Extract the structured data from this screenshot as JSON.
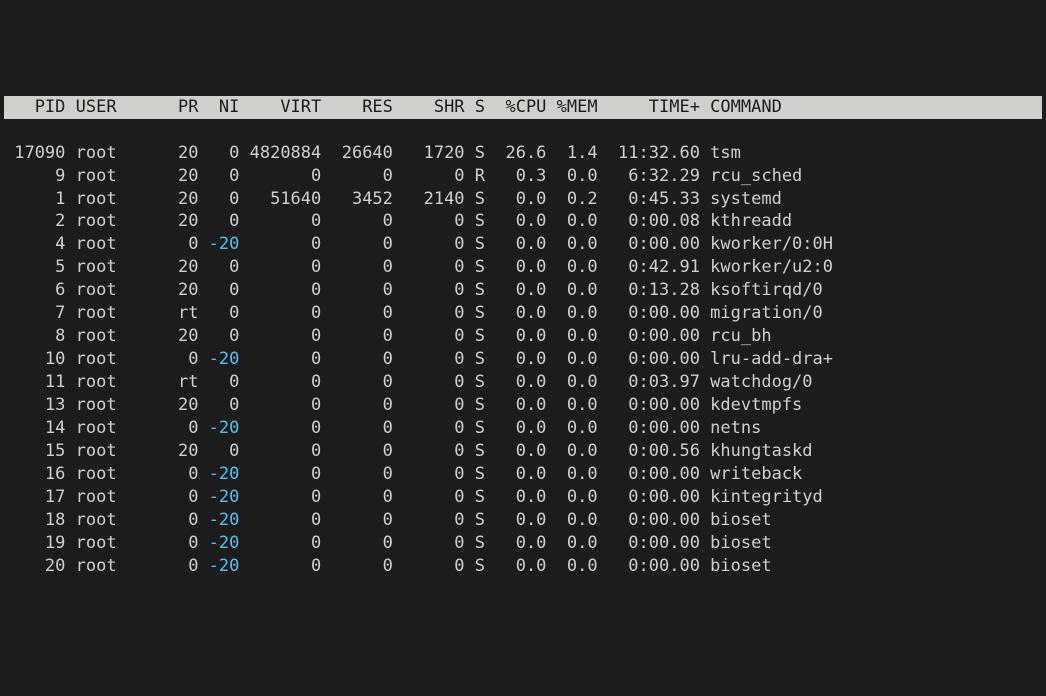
{
  "headers": {
    "pid": "PID",
    "user": "USER",
    "pr": "PR",
    "ni": "NI",
    "virt": "VIRT",
    "res": "RES",
    "shr": "SHR",
    "s": "S",
    "cpu": "%CPU",
    "mem": "%MEM",
    "time": "TIME+",
    "cmd": "COMMAND"
  },
  "rows": [
    {
      "pid": "17090",
      "user": "root",
      "pr": "20",
      "ni": "0",
      "virt": "4820884",
      "res": "26640",
      "shr": "1720",
      "s": "S",
      "cpu": "26.6",
      "mem": "1.4",
      "time": "11:32.60",
      "cmd": "tsm"
    },
    {
      "pid": "9",
      "user": "root",
      "pr": "20",
      "ni": "0",
      "virt": "0",
      "res": "0",
      "shr": "0",
      "s": "R",
      "cpu": "0.3",
      "mem": "0.0",
      "time": "6:32.29",
      "cmd": "rcu_sched"
    },
    {
      "pid": "1",
      "user": "root",
      "pr": "20",
      "ni": "0",
      "virt": "51640",
      "res": "3452",
      "shr": "2140",
      "s": "S",
      "cpu": "0.0",
      "mem": "0.2",
      "time": "0:45.33",
      "cmd": "systemd"
    },
    {
      "pid": "2",
      "user": "root",
      "pr": "20",
      "ni": "0",
      "virt": "0",
      "res": "0",
      "shr": "0",
      "s": "S",
      "cpu": "0.0",
      "mem": "0.0",
      "time": "0:00.08",
      "cmd": "kthreadd"
    },
    {
      "pid": "4",
      "user": "root",
      "pr": "0",
      "ni": "-20",
      "virt": "0",
      "res": "0",
      "shr": "0",
      "s": "S",
      "cpu": "0.0",
      "mem": "0.0",
      "time": "0:00.00",
      "cmd": "kworker/0:0H"
    },
    {
      "pid": "5",
      "user": "root",
      "pr": "20",
      "ni": "0",
      "virt": "0",
      "res": "0",
      "shr": "0",
      "s": "S",
      "cpu": "0.0",
      "mem": "0.0",
      "time": "0:42.91",
      "cmd": "kworker/u2:0"
    },
    {
      "pid": "6",
      "user": "root",
      "pr": "20",
      "ni": "0",
      "virt": "0",
      "res": "0",
      "shr": "0",
      "s": "S",
      "cpu": "0.0",
      "mem": "0.0",
      "time": "0:13.28",
      "cmd": "ksoftirqd/0"
    },
    {
      "pid": "7",
      "user": "root",
      "pr": "rt",
      "ni": "0",
      "virt": "0",
      "res": "0",
      "shr": "0",
      "s": "S",
      "cpu": "0.0",
      "mem": "0.0",
      "time": "0:00.00",
      "cmd": "migration/0"
    },
    {
      "pid": "8",
      "user": "root",
      "pr": "20",
      "ni": "0",
      "virt": "0",
      "res": "0",
      "shr": "0",
      "s": "S",
      "cpu": "0.0",
      "mem": "0.0",
      "time": "0:00.00",
      "cmd": "rcu_bh"
    },
    {
      "pid": "10",
      "user": "root",
      "pr": "0",
      "ni": "-20",
      "virt": "0",
      "res": "0",
      "shr": "0",
      "s": "S",
      "cpu": "0.0",
      "mem": "0.0",
      "time": "0:00.00",
      "cmd": "lru-add-dra+"
    },
    {
      "pid": "11",
      "user": "root",
      "pr": "rt",
      "ni": "0",
      "virt": "0",
      "res": "0",
      "shr": "0",
      "s": "S",
      "cpu": "0.0",
      "mem": "0.0",
      "time": "0:03.97",
      "cmd": "watchdog/0"
    },
    {
      "pid": "13",
      "user": "root",
      "pr": "20",
      "ni": "0",
      "virt": "0",
      "res": "0",
      "shr": "0",
      "s": "S",
      "cpu": "0.0",
      "mem": "0.0",
      "time": "0:00.00",
      "cmd": "kdevtmpfs"
    },
    {
      "pid": "14",
      "user": "root",
      "pr": "0",
      "ni": "-20",
      "virt": "0",
      "res": "0",
      "shr": "0",
      "s": "S",
      "cpu": "0.0",
      "mem": "0.0",
      "time": "0:00.00",
      "cmd": "netns"
    },
    {
      "pid": "15",
      "user": "root",
      "pr": "20",
      "ni": "0",
      "virt": "0",
      "res": "0",
      "shr": "0",
      "s": "S",
      "cpu": "0.0",
      "mem": "0.0",
      "time": "0:00.56",
      "cmd": "khungtaskd"
    },
    {
      "pid": "16",
      "user": "root",
      "pr": "0",
      "ni": "-20",
      "virt": "0",
      "res": "0",
      "shr": "0",
      "s": "S",
      "cpu": "0.0",
      "mem": "0.0",
      "time": "0:00.00",
      "cmd": "writeback"
    },
    {
      "pid": "17",
      "user": "root",
      "pr": "0",
      "ni": "-20",
      "virt": "0",
      "res": "0",
      "shr": "0",
      "s": "S",
      "cpu": "0.0",
      "mem": "0.0",
      "time": "0:00.00",
      "cmd": "kintegrityd"
    },
    {
      "pid": "18",
      "user": "root",
      "pr": "0",
      "ni": "-20",
      "virt": "0",
      "res": "0",
      "shr": "0",
      "s": "S",
      "cpu": "0.0",
      "mem": "0.0",
      "time": "0:00.00",
      "cmd": "bioset"
    },
    {
      "pid": "19",
      "user": "root",
      "pr": "0",
      "ni": "-20",
      "virt": "0",
      "res": "0",
      "shr": "0",
      "s": "S",
      "cpu": "0.0",
      "mem": "0.0",
      "time": "0:00.00",
      "cmd": "bioset"
    },
    {
      "pid": "20",
      "user": "root",
      "pr": "0",
      "ni": "-20",
      "virt": "0",
      "res": "0",
      "shr": "0",
      "s": "S",
      "cpu": "0.0",
      "mem": "0.0",
      "time": "0:00.00",
      "cmd": "bioset"
    }
  ]
}
